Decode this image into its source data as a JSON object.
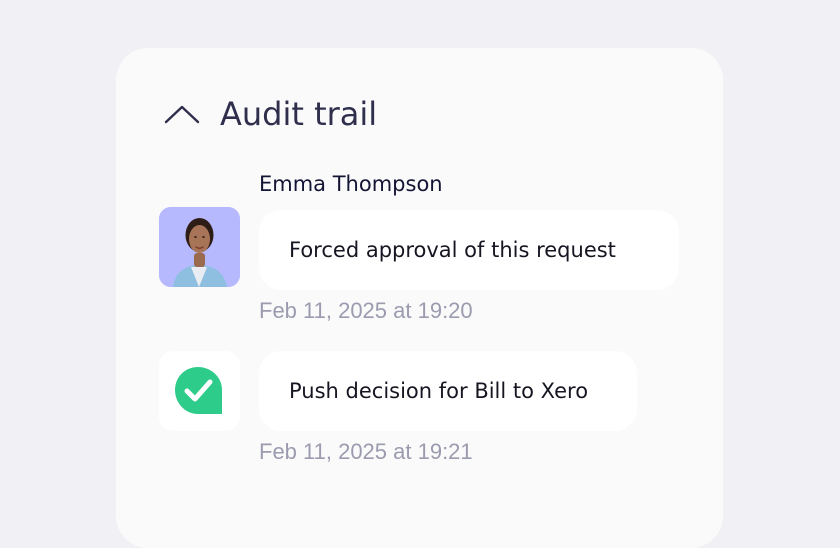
{
  "section": {
    "title": "Audit trail",
    "collapse_icon": "chevron-up-icon"
  },
  "entries": [
    {
      "author": "Emma Thompson",
      "avatar": "user-avatar-photo",
      "message": "Forced approval of this request",
      "timestamp": "Feb 11, 2025 at 19:20"
    },
    {
      "icon": "check-badge-icon",
      "message": "Push decision for Bill to Xero",
      "timestamp": "Feb 11, 2025 at 19:21"
    }
  ],
  "colors": {
    "page_background": "#f0f0f5",
    "card_background": "#fafafb",
    "bubble_background": "#ffffff",
    "avatar_background": "#b7b9ff",
    "success_green": "#2ecc8a",
    "timestamp_text": "#9b9baf"
  }
}
